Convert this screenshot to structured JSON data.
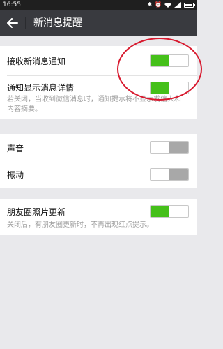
{
  "status_bar": {
    "time": "16:55",
    "icons": [
      "bluetooth-icon",
      "alarm-icon",
      "wifi-icon",
      "signal-icon",
      "battery-icon"
    ],
    "battery_level": 0.8
  },
  "app_bar": {
    "title": "新消息提醒",
    "back_icon": "arrow-left-icon",
    "background": "#393a3f"
  },
  "groups": [
    {
      "rows": [
        {
          "label": "接收新消息通知",
          "toggle": true
        },
        {
          "label": "通知显示消息详情",
          "toggle": true,
          "description": "若关闭，当收到微信消息时，通知提示将不显示发信人和内容摘要。"
        }
      ]
    },
    {
      "rows": [
        {
          "label": "声音",
          "toggle": false
        },
        {
          "label": "振动",
          "toggle": false
        }
      ]
    },
    {
      "rows": [
        {
          "label": "朋友圈照片更新",
          "toggle": true,
          "description": "关闭后，有朋友圈更新时，不再出现红点提示。"
        }
      ]
    }
  ],
  "colors": {
    "toggle_on": "#45c01a",
    "toggle_off": "#a8a8a8",
    "annotation_circle": "#d8192e",
    "background": "#e9e9ec"
  }
}
